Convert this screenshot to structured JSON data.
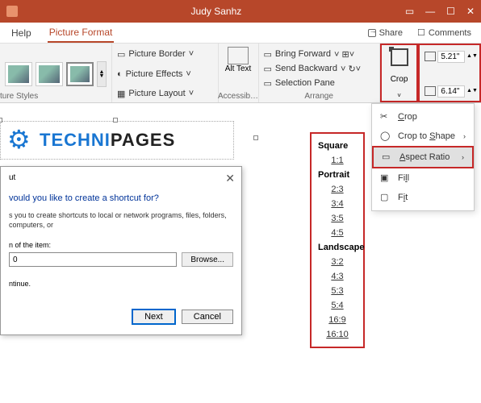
{
  "titlebar": {
    "title": "Judy Sanhz"
  },
  "menubar": {
    "help": "Help",
    "picture_format": "Picture Format",
    "share": "Share",
    "comments": "Comments"
  },
  "ribbon": {
    "styles_label": "ture Styles",
    "picture_border": "Picture Border",
    "picture_effects": "Picture Effects",
    "picture_layout": "Picture Layout",
    "alt_text": "Alt Text",
    "accessib": "Accessib…",
    "bring_forward": "Bring Forward",
    "send_backward": "Send Backward",
    "selection_pane": "Selection Pane",
    "arrange": "Arrange",
    "crop": "Crop",
    "height": "5.21\"",
    "width": "6.14\""
  },
  "cropmenu": {
    "crop": "Crop",
    "crop_to_shape": "Crop to Shape",
    "aspect_ratio": "Aspect Ratio",
    "fill": "Fill",
    "fit": "Fit"
  },
  "ratios": {
    "square_hdr": "Square",
    "square": [
      "1:1"
    ],
    "portrait_hdr": "Portrait",
    "portrait": [
      "2:3",
      "3:4",
      "3:5",
      "4:5"
    ],
    "landscape_hdr": "Landscape",
    "landscape": [
      "3:2",
      "4:3",
      "5:3",
      "5:4",
      "16:9",
      "16:10"
    ]
  },
  "logo": {
    "blue": "TECHNI",
    "black": "PAGES"
  },
  "wizard": {
    "title": "ut",
    "question": "vould you like to create a shortcut for?",
    "description": "s you to create shortcuts to local or network programs, files, folders, computers, or",
    "item_label": "n of the item:",
    "item_value": "0",
    "browse": "Browse...",
    "continue": "ntinue.",
    "next": "Next",
    "cancel": "Cancel"
  }
}
